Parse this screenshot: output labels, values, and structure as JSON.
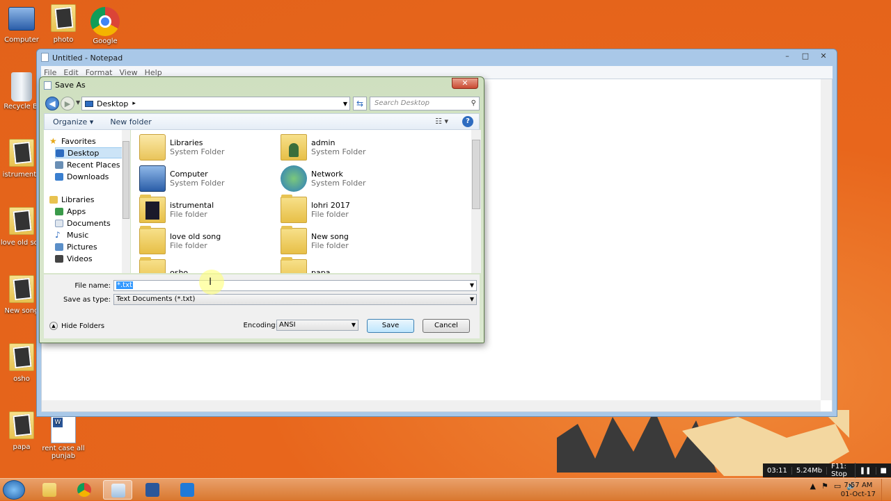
{
  "desktop": {
    "icons": [
      {
        "label": "Computer"
      },
      {
        "label": "photo"
      },
      {
        "label": "Google"
      },
      {
        "label": "Recycle Bi"
      },
      {
        "label": "istrumenta"
      },
      {
        "label": "love old son"
      },
      {
        "label": "New song"
      },
      {
        "label": "osho"
      },
      {
        "label": "papa"
      },
      {
        "label": "rent case all punjab"
      }
    ]
  },
  "notepad": {
    "title": "Untitled - Notepad",
    "controls": {
      "minimize": "–",
      "maximize": "□",
      "close": "✕"
    },
    "menu": [
      "File",
      "Edit",
      "Format",
      "View",
      "Help"
    ]
  },
  "dialog": {
    "title": "Save As",
    "close": "✕",
    "address": {
      "location": "Desktop",
      "separator": "▸"
    },
    "search_placeholder": "Search Desktop",
    "toolbar": {
      "organize": "Organize ▾",
      "new_folder": "New folder",
      "help": "?"
    },
    "nav_pane": {
      "items": [
        {
          "label": "Favorites",
          "icon": "star-icon"
        },
        {
          "label": "Desktop",
          "icon": "desktop-icon",
          "selected": true
        },
        {
          "label": "Recent Places",
          "icon": "recent-places-icon"
        },
        {
          "label": "Downloads",
          "icon": "downloads-icon"
        },
        {
          "label": "Libraries",
          "icon": "library-icon"
        },
        {
          "label": "Apps",
          "icon": "apps-icon"
        },
        {
          "label": "Documents",
          "icon": "documents-icon"
        },
        {
          "label": "Music",
          "icon": "music-icon"
        },
        {
          "label": "Pictures",
          "icon": "pictures-icon"
        },
        {
          "label": "Videos",
          "icon": "videos-icon"
        }
      ]
    },
    "files": [
      {
        "name": "Libraries",
        "type": "System Folder",
        "icon": "libraries-icon"
      },
      {
        "name": "admin",
        "type": "System Folder",
        "icon": "user-folder-icon"
      },
      {
        "name": "Computer",
        "type": "System Folder",
        "icon": "computer-icon"
      },
      {
        "name": "Network",
        "type": "System Folder",
        "icon": "network-icon"
      },
      {
        "name": "istrumental",
        "type": "File folder",
        "icon": "folder-icon"
      },
      {
        "name": "lohri 2017",
        "type": "File folder",
        "icon": "folder-icon"
      },
      {
        "name": "love old song",
        "type": "File folder",
        "icon": "folder-icon"
      },
      {
        "name": "New  song",
        "type": "File folder",
        "icon": "folder-icon"
      },
      {
        "name": "osho",
        "type": "",
        "icon": "folder-icon"
      },
      {
        "name": "papa",
        "type": "",
        "icon": "folder-icon"
      }
    ],
    "file_name": {
      "label": "File name:",
      "value": "*.txt"
    },
    "save_as_type": {
      "label": "Save as type:",
      "value": "Text Documents (*.txt)"
    },
    "encoding": {
      "label": "Encoding:",
      "value": "ANSI"
    },
    "buttons": {
      "save": "Save",
      "cancel": "Cancel",
      "hide_folders": "Hide Folders"
    }
  },
  "recorder": {
    "time": "03:11",
    "size": "5.24Mb",
    "stop": "F11: Stop",
    "pause": "❚❚",
    "square": "■"
  },
  "taskbar": {
    "clock_time": "7:57 AM",
    "clock_date": "01-Oct-17",
    "tray_icons": [
      "▲",
      "⚑",
      "▭",
      "🔊"
    ]
  }
}
